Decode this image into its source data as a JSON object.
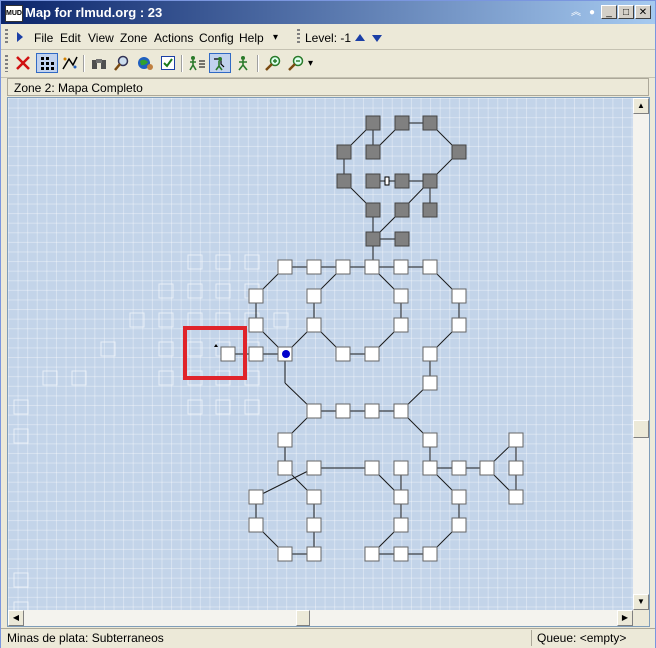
{
  "window": {
    "title": "Map for rlmud.org : 23",
    "app_icon_text": "MUD"
  },
  "menu": {
    "items": [
      {
        "label": "File"
      },
      {
        "label": "Edit"
      },
      {
        "label": "View"
      },
      {
        "label": "Zone"
      },
      {
        "label": "Actions"
      },
      {
        "label": "Config"
      },
      {
        "label": "Help"
      }
    ],
    "overflow_arrow": "▾",
    "level_label": "Level: -1"
  },
  "toolbar": {
    "tools": [
      {
        "name": "delete-icon"
      },
      {
        "name": "grid-snap-icon"
      },
      {
        "name": "pattern-icon"
      },
      {
        "name": "binoculars-icon"
      },
      {
        "name": "magnify-icon"
      },
      {
        "name": "globe-user-icon"
      },
      {
        "name": "check-box-icon"
      },
      {
        "name": "walk-list-icon"
      },
      {
        "name": "speedwalk-icon"
      },
      {
        "name": "runner-icon"
      },
      {
        "name": "zoom-in-icon"
      },
      {
        "name": "zoom-out-icon"
      }
    ],
    "zoom_menu_arrow": "▾"
  },
  "zone": {
    "label": "Zone 2: Mapa Completo"
  },
  "status": {
    "left": "Minas de plata: Subterraneos",
    "right": "Queue: <empty>"
  },
  "colors": {
    "map_bg": "#c3d4e9",
    "room_fill": "#ffffff",
    "upper_room_fill": "#808080",
    "highlight": "#e0232a",
    "player": "#0000cc"
  }
}
